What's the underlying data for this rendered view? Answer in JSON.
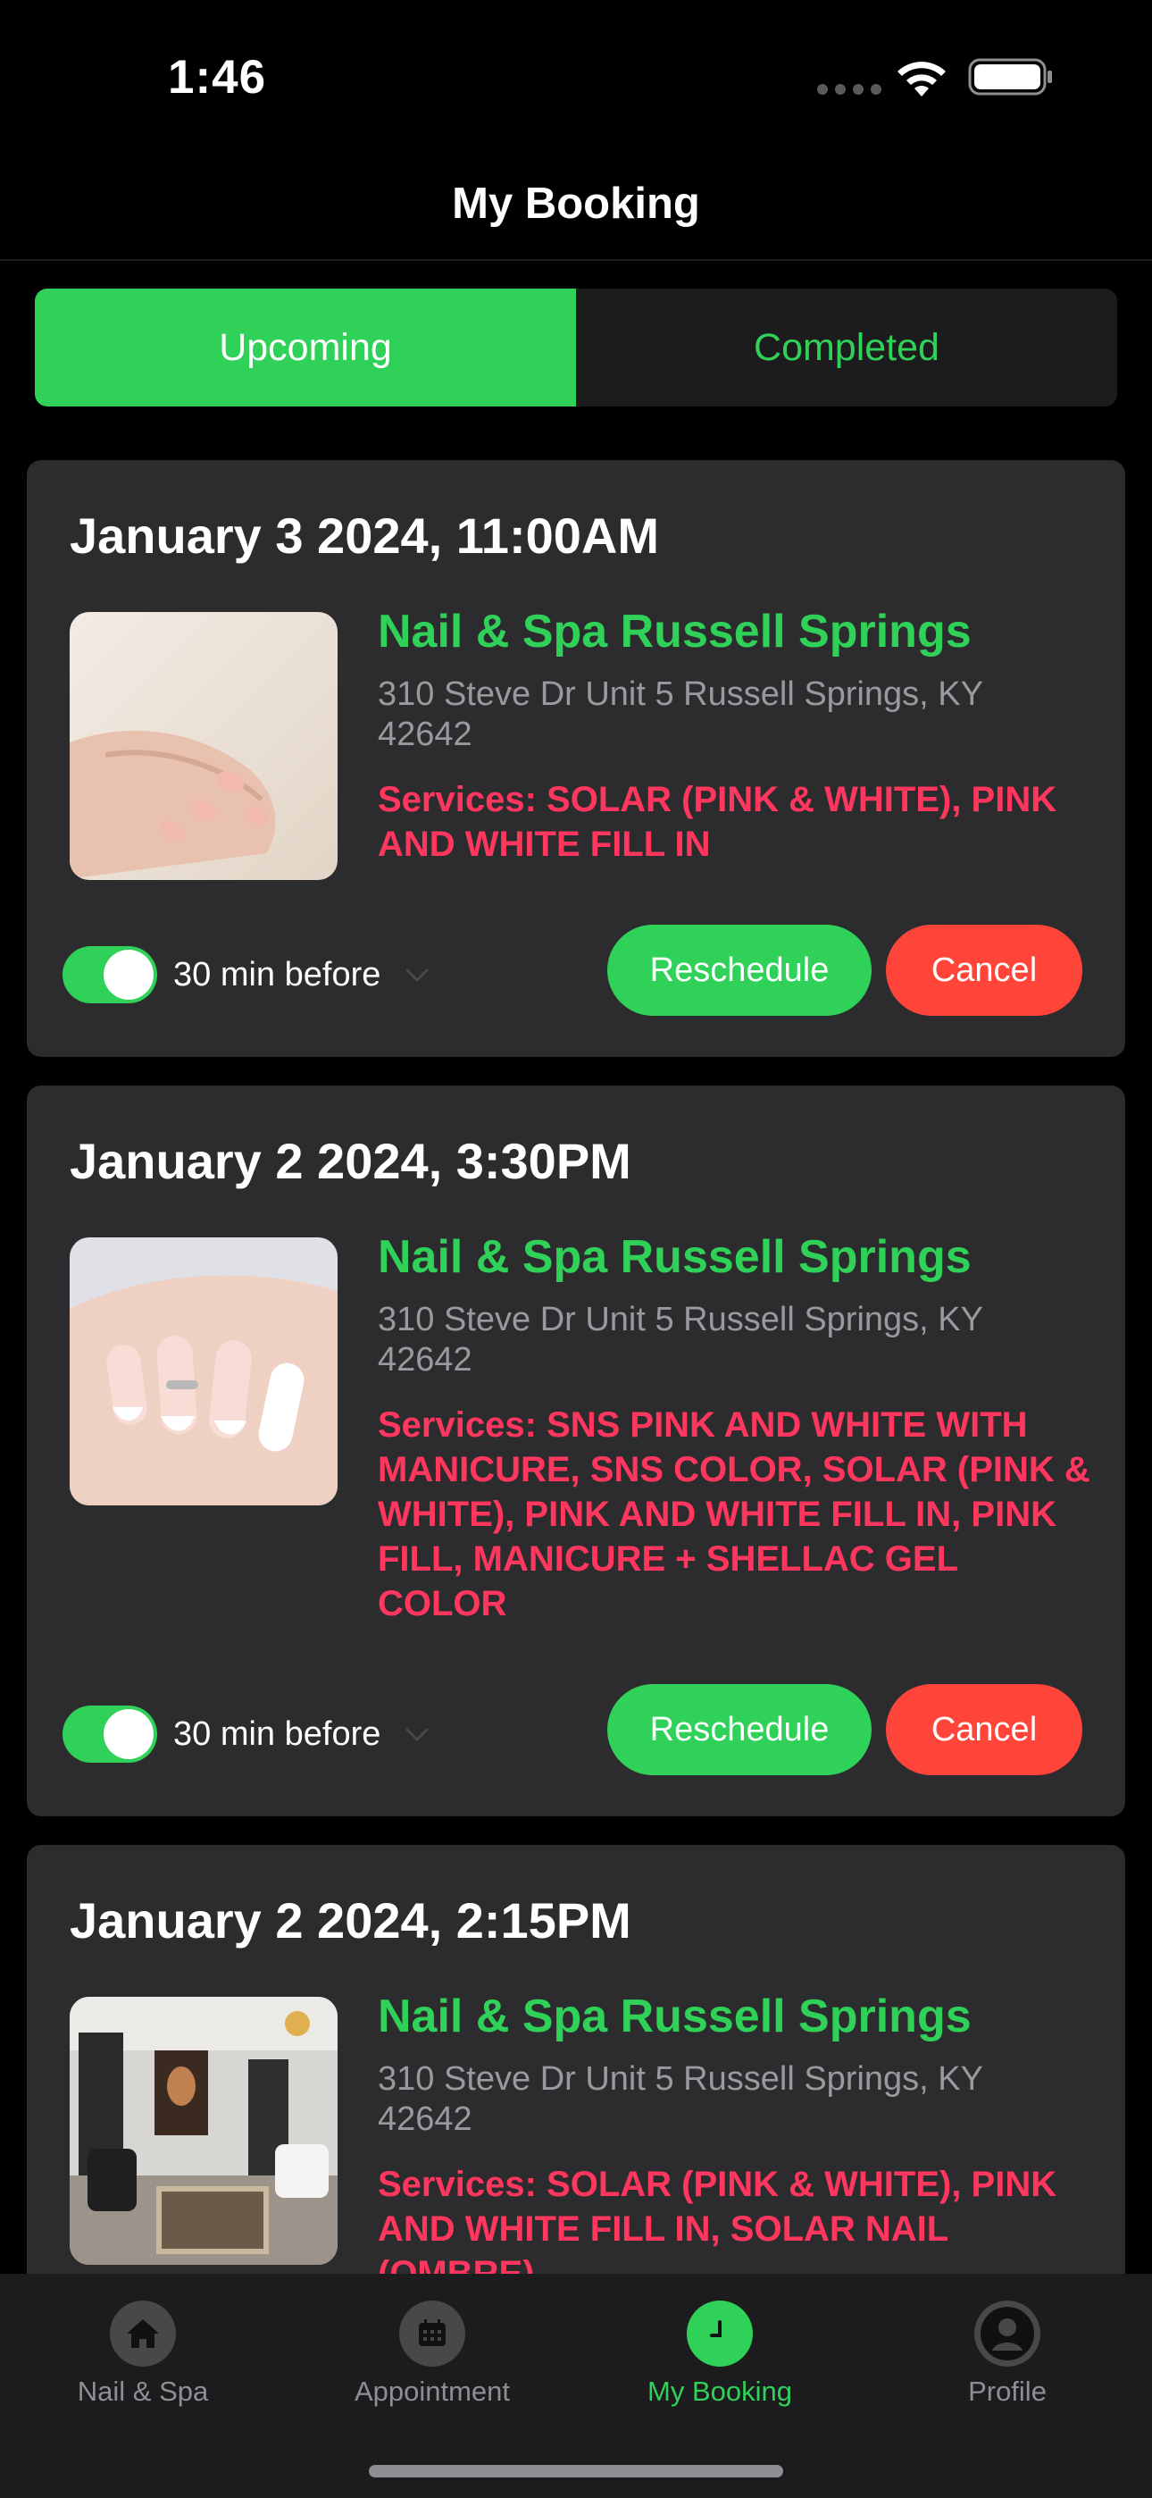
{
  "status_bar": {
    "time": "1:46"
  },
  "header": {
    "title": "My Booking"
  },
  "tabs": [
    {
      "label": "Upcoming",
      "active": true
    },
    {
      "label": "Completed",
      "active": false
    }
  ],
  "bookings": [
    {
      "datetime": "January 3 2024, 11:00AM",
      "salon": "Nail & Spa Russell Springs",
      "address": "310 Steve Dr Unit 5 Russell Springs, KY 42642",
      "services": "Services: SOLAR (PINK & WHITE), PINK AND WHITE FILL IN",
      "reminder_enabled": true,
      "reminder": "30 min before",
      "reschedule_label": "Reschedule",
      "cancel_label": "Cancel",
      "thumbnail": "nail-hand-photo"
    },
    {
      "datetime": "January 2 2024, 3:30PM",
      "salon": "Nail & Spa Russell Springs",
      "address": "310 Steve Dr Unit 5 Russell Springs, KY 42642",
      "services": "Services: SNS PINK AND WHITE WITH MANICURE, SNS COLOR, SOLAR (PINK & WHITE), PINK AND WHITE FILL IN, PINK FILL, MANICURE + SHELLAC GEL COLOR",
      "reminder_enabled": true,
      "reminder": "30 min before",
      "reschedule_label": "Reschedule",
      "cancel_label": "Cancel",
      "thumbnail": "french-manicure-photo"
    },
    {
      "datetime": "January 2 2024, 2:15PM",
      "salon": "Nail & Spa Russell Springs",
      "address": "310 Steve Dr Unit 5 Russell Springs, KY 42642",
      "services": "Services: SOLAR (PINK & WHITE), PINK AND WHITE FILL IN, SOLAR NAIL (OMBRE)",
      "thumbnail": "salon-interior-photo"
    }
  ],
  "tab_bar": [
    {
      "label": "Nail & Spa",
      "icon": "home-icon",
      "active": false
    },
    {
      "label": "Appointment",
      "icon": "calendar-icon",
      "active": false
    },
    {
      "label": "My Booking",
      "icon": "clock-icon",
      "active": true
    },
    {
      "label": "Profile",
      "icon": "person-icon",
      "active": false
    }
  ],
  "colors": {
    "accent_green": "#30d158",
    "cancel_red": "#ff453a",
    "services_pink": "#ff375f",
    "card_bg": "#2c2c2e",
    "tab_bar_bg": "#1c1c1e"
  }
}
